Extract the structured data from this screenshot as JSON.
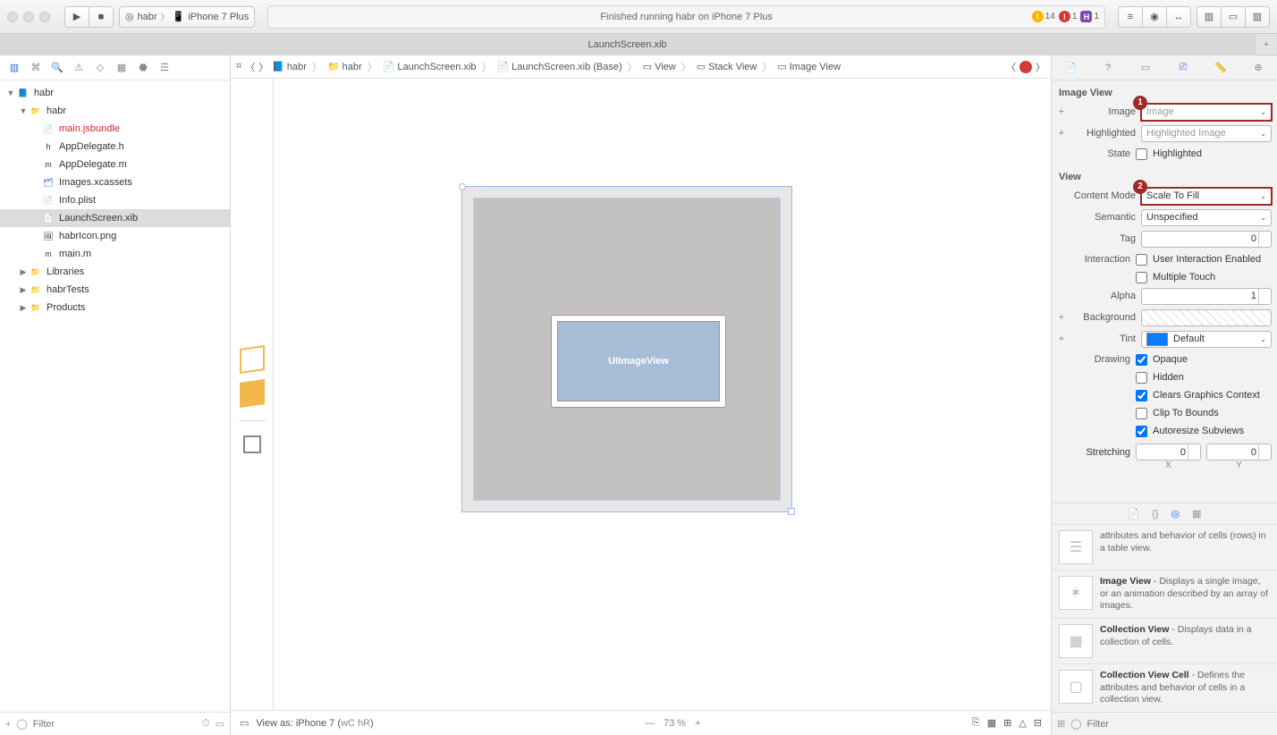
{
  "titlebar": {
    "scheme_target": "habr",
    "scheme_device": "iPhone 7 Plus",
    "status_text": "Finished running habr on iPhone 7 Plus",
    "warn_count": "14",
    "err_count": "1",
    "purple_count": "1"
  },
  "tabbar": {
    "active_tab": "LaunchScreen.xib"
  },
  "navigator": {
    "project": "habr",
    "group": "habr",
    "files": [
      {
        "name": "main.jsbundle",
        "red": true
      },
      {
        "name": "AppDelegate.h"
      },
      {
        "name": "AppDelegate.m"
      },
      {
        "name": "Images.xcassets"
      },
      {
        "name": "Info.plist"
      },
      {
        "name": "LaunchScreen.xib",
        "sel": true
      },
      {
        "name": "habrIcon.png"
      },
      {
        "name": "main.m"
      }
    ],
    "groups": [
      {
        "name": "Libraries"
      },
      {
        "name": "habrTests"
      },
      {
        "name": "Products"
      }
    ],
    "filter_placeholder": "Filter"
  },
  "jumpbar": {
    "items": [
      "habr",
      "habr",
      "LaunchScreen.xib",
      "LaunchScreen.xib (Base)",
      "View",
      "Stack View",
      "Image View"
    ]
  },
  "canvas": {
    "uiimage_label": "UIImageView"
  },
  "editor_bottom": {
    "view_as": "View as: iPhone 7 (",
    "wc": "wC",
    "hr": "hR",
    "close": ")",
    "zoom": "73 %"
  },
  "inspector": {
    "sect_image": "Image View",
    "image_label": "Image",
    "image_placeholder": "Image",
    "highlighted_label": "Highlighted",
    "highlighted_placeholder": "Highlighted Image",
    "state_label": "State",
    "state_option": "Highlighted",
    "sect_view": "View",
    "content_mode_label": "Content Mode",
    "content_mode_value": "Scale To Fill",
    "semantic_label": "Semantic",
    "semantic_value": "Unspecified",
    "tag_label": "Tag",
    "tag_value": "0",
    "interaction_label": "Interaction",
    "interaction_opts": [
      "User Interaction Enabled",
      "Multiple Touch"
    ],
    "alpha_label": "Alpha",
    "alpha_value": "1",
    "background_label": "Background",
    "tint_label": "Tint",
    "tint_value": "Default",
    "drawing_label": "Drawing",
    "drawing_opts": [
      {
        "label": "Opaque",
        "checked": true
      },
      {
        "label": "Hidden",
        "checked": false
      },
      {
        "label": "Clears Graphics Context",
        "checked": true
      },
      {
        "label": "Clip To Bounds",
        "checked": false
      },
      {
        "label": "Autoresize Subviews",
        "checked": true
      }
    ],
    "stretching_label": "Stretching",
    "stretch_x": "0",
    "stretch_y": "0",
    "axis_x": "X",
    "axis_y": "Y",
    "callout1": "1",
    "callout2": "2"
  },
  "library": {
    "items": [
      {
        "title": "",
        "desc": "attributes and behavior of cells (rows) in a table view."
      },
      {
        "title": "Image View",
        "desc": " - Displays a single image, or an animation described by an array of images."
      },
      {
        "title": "Collection View",
        "desc": " - Displays data in a collection of cells."
      },
      {
        "title": "Collection View Cell",
        "desc": " - Defines the attributes and behavior of cells in a collection view."
      }
    ],
    "filter_placeholder": "Filter"
  }
}
